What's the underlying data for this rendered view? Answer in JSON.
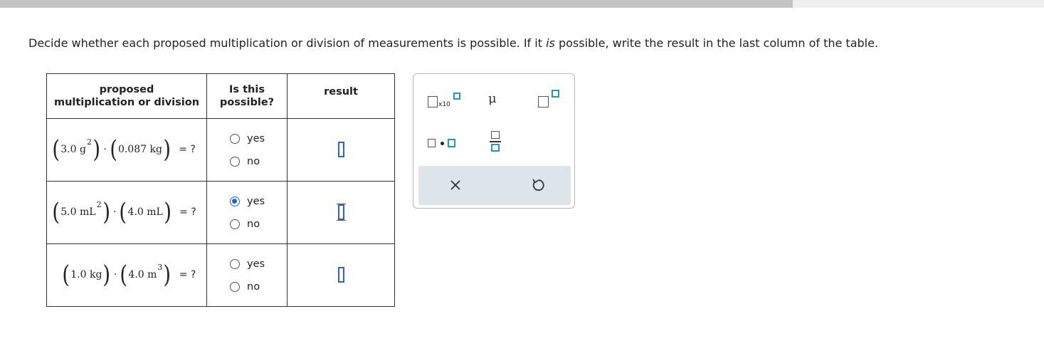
{
  "progress": {
    "fraction": 0.76
  },
  "instruction": {
    "part1": "Decide whether each proposed multiplication or division of measurements is possible. If it ",
    "emph": "is",
    "part2": " possible, write the result in the last column of the table."
  },
  "table": {
    "headers": {
      "col1_line1": "proposed",
      "col1_line2": "multiplication or division",
      "col2_line1": "Is this",
      "col2_line2": "possible?",
      "col3": "result"
    },
    "rows": [
      {
        "left_num": "3.0",
        "left_unit": "g",
        "left_exp": "2",
        "right_num": "0.087",
        "right_unit": "kg",
        "right_exp": "",
        "operator": "·",
        "equals": "= ?",
        "yes_label": "yes",
        "no_label": "no",
        "selected": "none"
      },
      {
        "left_num": "5.0",
        "left_unit": "mL",
        "left_exp": "2",
        "right_num": "4.0",
        "right_unit": "mL",
        "right_exp": "",
        "operator": "·",
        "equals": "= ?",
        "yes_label": "yes",
        "no_label": "no",
        "selected": "yes"
      },
      {
        "left_num": "1.0",
        "left_unit": "kg",
        "left_exp": "",
        "right_num": "4.0",
        "right_unit": "m",
        "right_exp": "3",
        "operator": "·",
        "equals": "= ?",
        "yes_label": "yes",
        "no_label": "no",
        "selected": "none"
      }
    ]
  },
  "keypad": {
    "x10_label": "x10",
    "mu_label": "μ",
    "accent_color": "#1c9db4",
    "answer_color": "#2d63c8",
    "selected_radio_color": "#1a66d2"
  }
}
